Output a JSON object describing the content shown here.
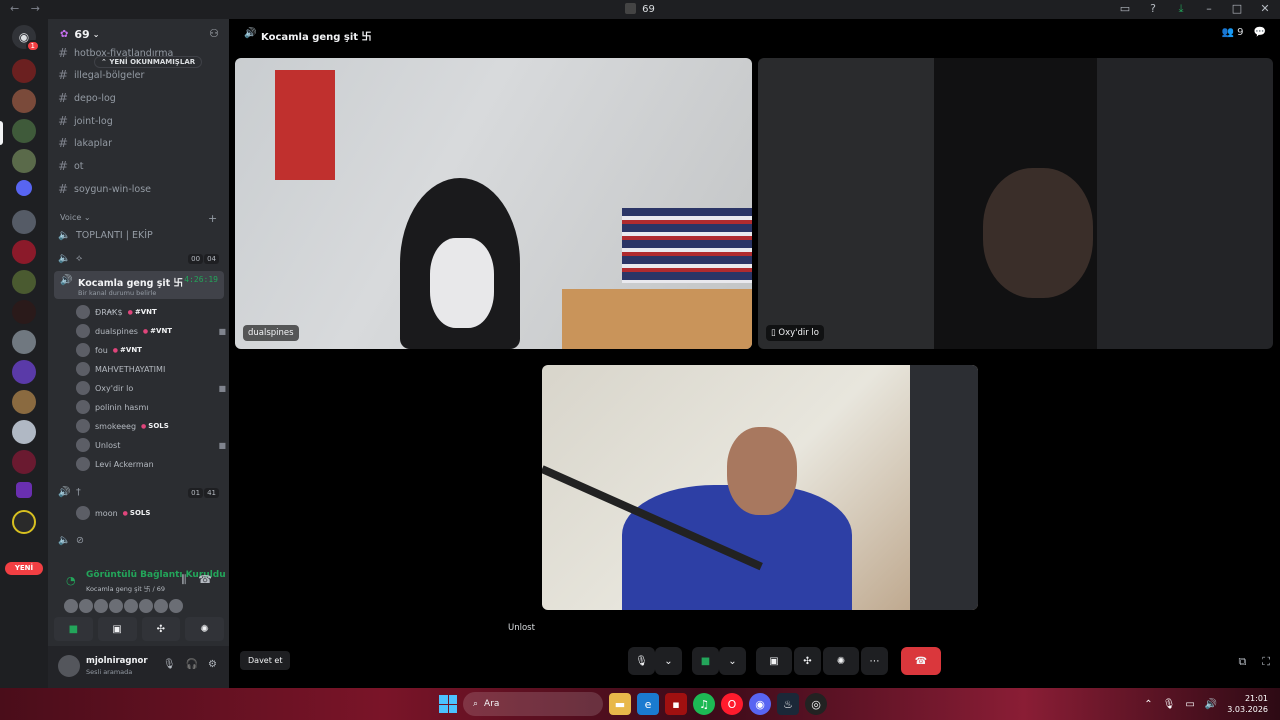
{
  "titlebar": {
    "title": "69"
  },
  "guild": {
    "name": "69",
    "unread_pill": "YENİ OKUNMAMIŞLAR"
  },
  "channels": {
    "text": [
      "hotbox-fiyatlandırma",
      "illegal-bölgeler",
      "depo-log",
      "joint-log",
      "lakaplar",
      "ot",
      "soygun-win-lose"
    ],
    "voice_category": "Voice",
    "voice": [
      {
        "name": "TOPLANTI | EKİP"
      },
      {
        "name": "⟡",
        "count_a": "00",
        "count_b": "04"
      }
    ],
    "active": {
      "name": "Kocamla geng şit 卐",
      "status": "Bir kanal durumu belirle",
      "time": "4:26:19"
    },
    "members": [
      {
        "name": "ÐR₳Ҟ$",
        "tag": "#VNT",
        "cam": false
      },
      {
        "name": "dualspines",
        "tag": "#VNT",
        "cam": true
      },
      {
        "name": "fou",
        "tag": "#VNT",
        "cam": false
      },
      {
        "name": "MAHVETHAYATIMI",
        "tag": "",
        "cam": false
      },
      {
        "name": "Oxy'dir lo",
        "tag": "",
        "cam": true
      },
      {
        "name": "polinin hasmı",
        "tag": "",
        "cam": false
      },
      {
        "name": "smokeeeg",
        "tag": "SOLS",
        "cam": false
      },
      {
        "name": "Unlost",
        "tag": "",
        "cam": true
      },
      {
        "name": "Levi Ackerman",
        "tag": "",
        "cam": false
      }
    ],
    "other_voice": {
      "name": "†",
      "count_a": "01",
      "count_b": "41"
    },
    "other_member": {
      "name": "moon",
      "tag": "SOLS"
    },
    "last_voice": "⊘"
  },
  "servers": {
    "yeni_label": "YENİ",
    "dm_badge": "1"
  },
  "voice_panel": {
    "status": "Görüntülü Bağlantı Kuruldu",
    "sub": "Kocamla geng şit 卐 / 69"
  },
  "user": {
    "name": "mjolniragnor",
    "status": "Sesli aramada"
  },
  "main": {
    "header": "Kocamla geng şit 卐",
    "participants": "9",
    "tiles": [
      {
        "name": "dualspines"
      },
      {
        "name": "Oxy'dir lo"
      },
      {
        "name": "Unlost"
      }
    ],
    "invite": "Davet et"
  },
  "taskbar": {
    "search": "Ara",
    "time": "21:01",
    "date": "3.03.2026"
  },
  "colors": {
    "accent_green": "#23a55a",
    "end_call": "#da373c",
    "bg": "#2b2d31"
  }
}
